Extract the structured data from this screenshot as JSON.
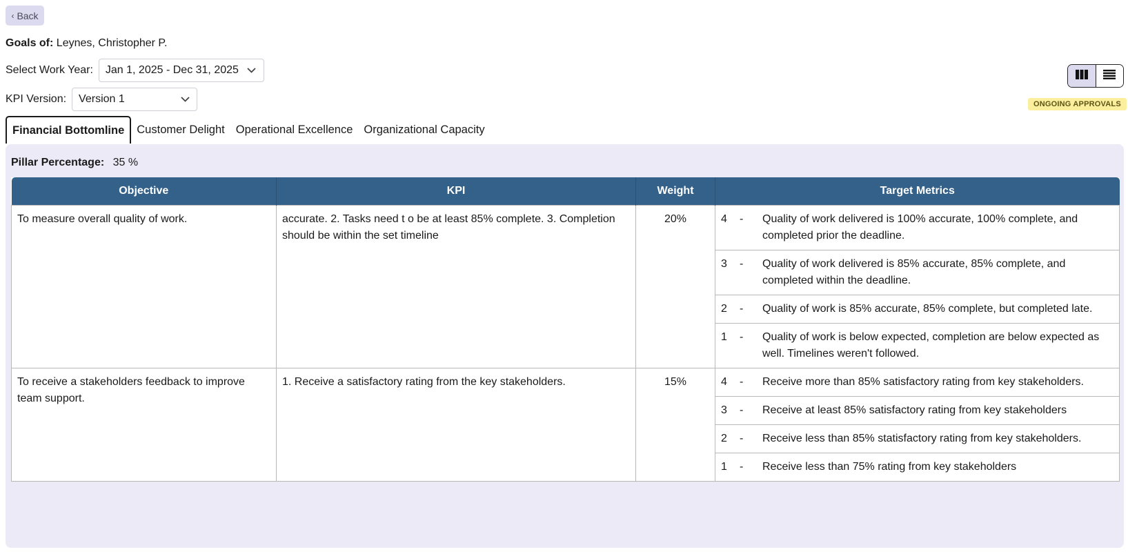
{
  "back_label": "Back",
  "goals_of": {
    "label": "Goals of:",
    "name": "Leynes, Christopher P."
  },
  "work_year": {
    "label": "Select Work Year:",
    "value": "Jan 1, 2025 - Dec 31, 2025"
  },
  "kpi_version": {
    "label": "KPI Version:",
    "value": "Version 1"
  },
  "status_badge": "ONGOING APPROVALS",
  "view_toggle": {
    "active": "column-view"
  },
  "tabs": [
    {
      "label": "Financial Bottomline",
      "active": true
    },
    {
      "label": "Customer Delight",
      "active": false
    },
    {
      "label": "Operational Excellence",
      "active": false
    },
    {
      "label": "Organizational Capacity",
      "active": false
    }
  ],
  "pillar": {
    "label": "Pillar Percentage:",
    "value": "35 %"
  },
  "table": {
    "headers": {
      "objective": "Objective",
      "kpi": "KPI",
      "weight": "Weight",
      "metrics": "Target Metrics"
    },
    "rows": [
      {
        "objective": "To measure overall quality of work.",
        "kpi": "accurate. 2. Tasks need t o be at least 85% complete. 3. Completion should be within the set timeline",
        "weight": "20%",
        "metrics": [
          {
            "level": "4",
            "sep": "-",
            "text": "Quality of work delivered is 100% accurate, 100% complete, and completed prior the deadline."
          },
          {
            "level": "3",
            "sep": "-",
            "text": "Quality of work delivered is 85% accurate, 85% complete, and completed within the deadline."
          },
          {
            "level": "2",
            "sep": "-",
            "text": "Quality of work is 85% accurate, 85% complete, but completed late."
          },
          {
            "level": "1",
            "sep": "-",
            "text": "Quality of work is below expected, completion are below expected as well. Timelines weren't followed."
          }
        ]
      },
      {
        "objective": "To receive a stakeholders feedback to improve team support.",
        "kpi": "1. Receive a satisfactory rating from the key stakeholders.",
        "weight": "15%",
        "metrics": [
          {
            "level": "4",
            "sep": "-",
            "text": "Receive more than 85% satisfactory rating from key stakeholders."
          },
          {
            "level": "3",
            "sep": "-",
            "text": "Receive at least 85% satisfactory rating from key stakeholders"
          },
          {
            "level": "2",
            "sep": "-",
            "text": "Receive less than 85% statisfactory rating from key stakeholders."
          },
          {
            "level": "1",
            "sep": "-",
            "text": "Receive less than 75% rating from key stakeholders"
          }
        ]
      }
    ]
  }
}
